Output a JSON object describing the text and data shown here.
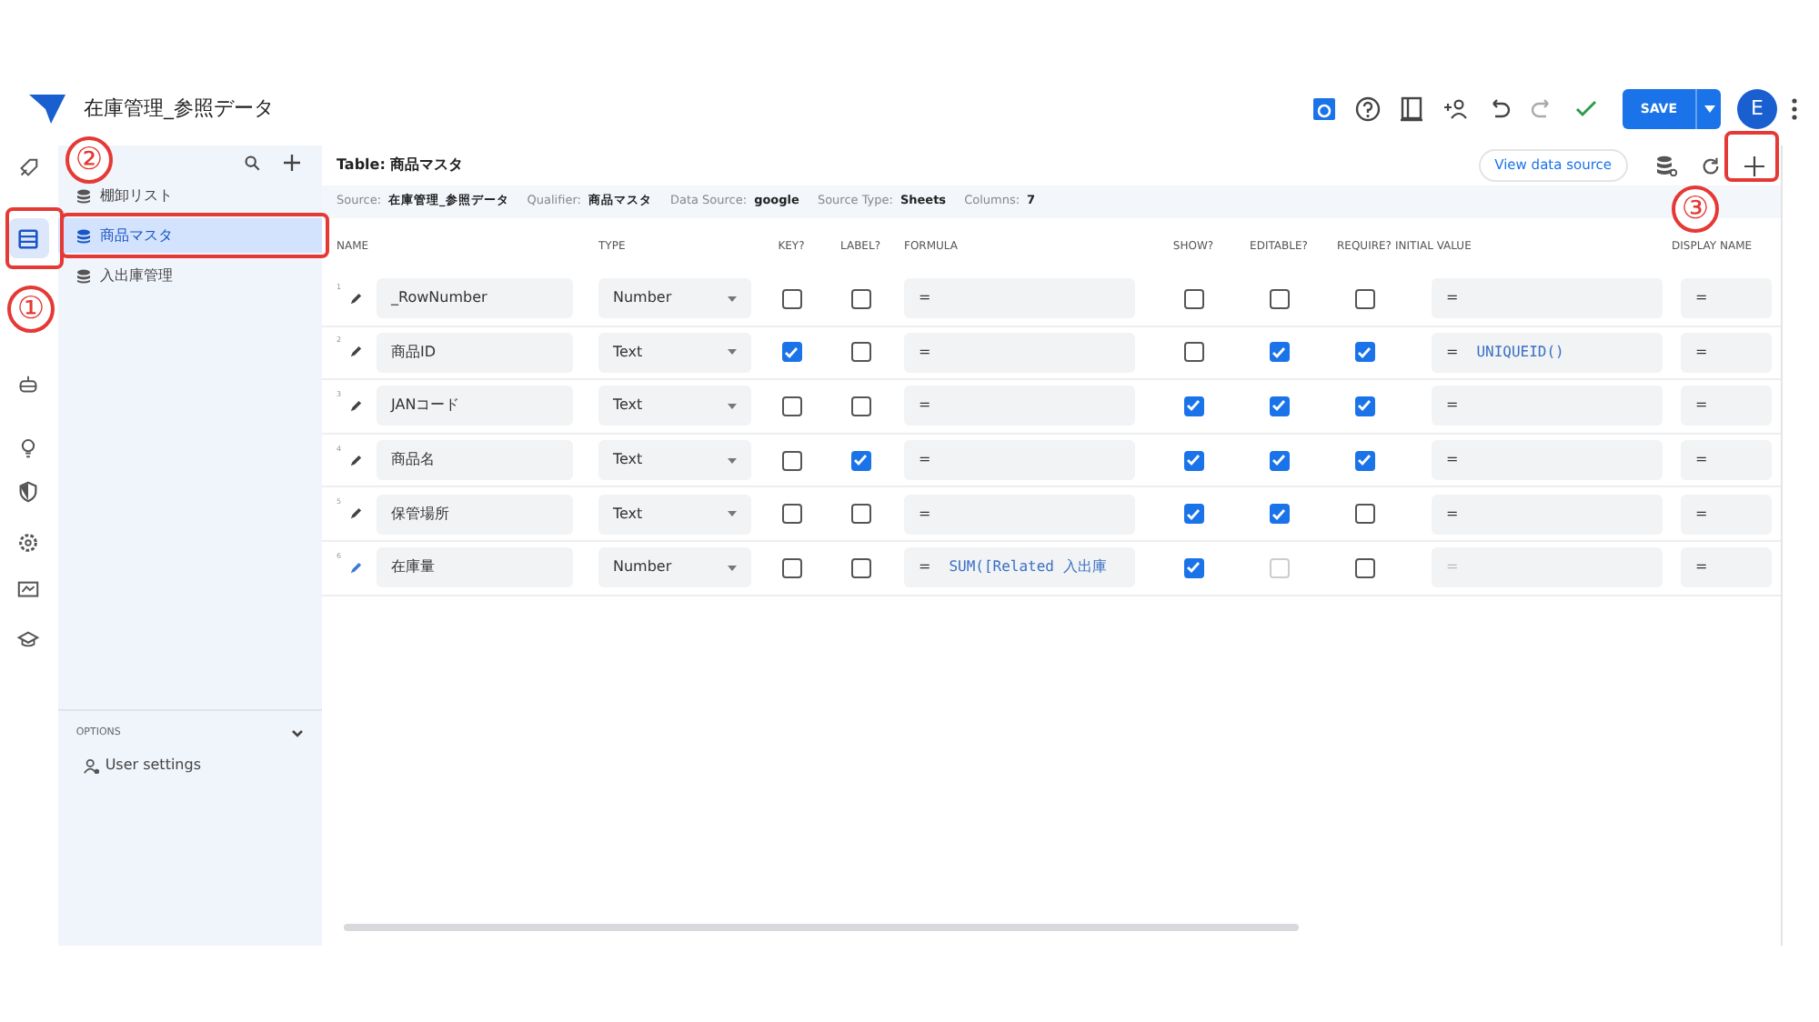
{
  "app": {
    "title": "在庫管理_参照データ"
  },
  "toolbar": {
    "save": "SAVE",
    "avatar": "E"
  },
  "rail": [
    {
      "selected": false
    },
    {
      "selected": true
    },
    {
      "selected": false
    },
    {
      "selected": false
    },
    {
      "selected": false
    },
    {
      "selected": false
    },
    {
      "selected": false
    },
    {
      "selected": false
    }
  ],
  "sidebar": {
    "items": [
      {
        "label": "棚卸リスト",
        "selected": false
      },
      {
        "label": "商品マスタ",
        "selected": true
      },
      {
        "label": "入出庫管理",
        "selected": false
      }
    ],
    "options_label": "OPTIONS",
    "options": [
      "User settings"
    ]
  },
  "table_header": {
    "title": "Table: 商品マスタ",
    "view_button": "View data source"
  },
  "meta": [
    {
      "label": "Source:",
      "value": "在庫管理_参照データ"
    },
    {
      "label": "Qualifier:",
      "value": "商品マスタ"
    },
    {
      "label": "Data Source:",
      "value": "google"
    },
    {
      "label": "Source Type:",
      "value": "Sheets"
    },
    {
      "label": "Columns:",
      "value": "7"
    }
  ],
  "columns": [
    "NAME",
    "TYPE",
    "KEY?",
    "LABEL?",
    "FORMULA",
    "SHOW?",
    "EDITABLE?",
    "REQUIRE?",
    "INITIAL VALUE",
    "DISPLAY NAME"
  ],
  "rows": [
    {
      "number": "1",
      "name": "_RowNumber",
      "type": "Number",
      "key": false,
      "label": false,
      "formula": "=",
      "show": false,
      "editable": false,
      "require": false,
      "initial_value": "=",
      "display_name": "=",
      "virtual": false
    },
    {
      "number": "2",
      "name": "商品ID",
      "type": "Text",
      "key": true,
      "label": false,
      "formula": "=",
      "show": false,
      "editable": true,
      "require": true,
      "initial_value": "=",
      "initial_expression": "UNIQUEID()",
      "display_name": "=",
      "virtual": false
    },
    {
      "number": "3",
      "name": "JANコード",
      "type": "Text",
      "key": false,
      "label": false,
      "formula": "=",
      "show": true,
      "editable": true,
      "require": true,
      "initial_value": "=",
      "display_name": "=",
      "virtual": false
    },
    {
      "number": "4",
      "name": "商品名",
      "type": "Text",
      "key": false,
      "label": true,
      "formula": "=",
      "show": true,
      "editable": true,
      "require": true,
      "initial_value": "=",
      "display_name": "=",
      "virtual": false
    },
    {
      "number": "5",
      "name": "保管場所",
      "type": "Text",
      "key": false,
      "label": false,
      "formula": "=",
      "show": true,
      "editable": true,
      "require": false,
      "initial_value": "=",
      "display_name": "=",
      "virtual": false
    },
    {
      "number": "6",
      "name": "在庫量",
      "type": "Number",
      "key": false,
      "label": false,
      "formula": "=",
      "formula_expression": "SUM([Related 入出庫",
      "show": true,
      "editable": false,
      "editable_disabled": true,
      "require": false,
      "initial_value": "=",
      "initial_disabled": true,
      "virtual": true,
      "display_name": "="
    }
  ],
  "annotations": [
    {
      "label": "①"
    },
    {
      "label": "②"
    },
    {
      "label": "③"
    }
  ]
}
